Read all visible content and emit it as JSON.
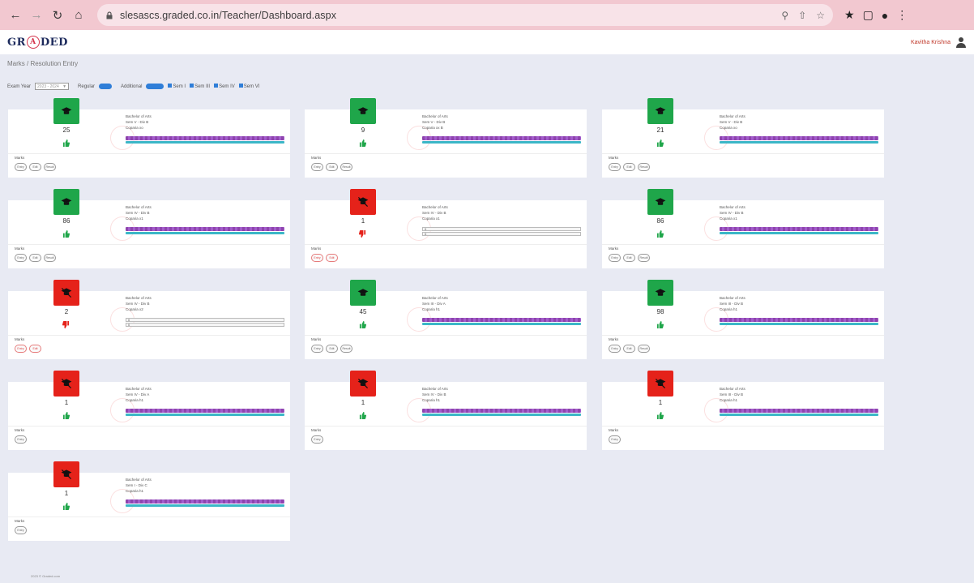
{
  "browser": {
    "url": "slesascs.graded.co.in/Teacher/Dashboard.aspx"
  },
  "app": {
    "logo_left": "GR",
    "logo_mid": "A",
    "logo_right": "DED",
    "user_name": "Kavitha Krishna"
  },
  "breadcrumb": "Marks / Resolution Entry",
  "filters": {
    "exam_year_label": "Exam Year",
    "exam_year_value": "2023 - 2024",
    "regular_label": "Regular",
    "additional_label": "Additional",
    "sems": [
      "Sem I",
      "Sem III",
      "Sem IV",
      "Sem VI"
    ]
  },
  "card_common": {
    "program": "Bachelor of Arts",
    "marks_label": "Marks"
  },
  "cards": [
    {
      "color": "green",
      "count": "25",
      "thumb": "up",
      "sem": "Sem V - Div B",
      "subject": "Coparia xo",
      "bars": "full",
      "buttons": [
        "Entry",
        "Edit",
        "Result"
      ]
    },
    {
      "color": "green",
      "count": "9",
      "thumb": "up",
      "sem": "Sem V - Div B",
      "subject": "Coparia xx B",
      "bars": "full",
      "buttons": [
        "Entry",
        "Edit",
        "Result"
      ]
    },
    {
      "color": "green",
      "count": "21",
      "thumb": "up",
      "sem": "Sem V - Div B",
      "subject": "Coparia xo",
      "bars": "full",
      "buttons": [
        "Entry",
        "Edit",
        "Result"
      ]
    },
    {
      "color": "green",
      "count": "86",
      "thumb": "up",
      "sem": "Sem IV - Div B",
      "subject": "Coparia x1",
      "bars": "full",
      "buttons": [
        "Entry",
        "Edit",
        "Result"
      ]
    },
    {
      "color": "red",
      "count": "1",
      "thumb": "down",
      "sem": "Sem IV - Div B",
      "subject": "Coparia x1",
      "bars": "empty",
      "buttons": [
        "Entry",
        "Edit"
      ]
    },
    {
      "color": "green",
      "count": "86",
      "thumb": "up",
      "sem": "Sem IV - Div B",
      "subject": "Coparia x1",
      "bars": "full",
      "buttons": [
        "Entry",
        "Edit",
        "Result"
      ]
    },
    {
      "color": "red",
      "count": "2",
      "thumb": "down",
      "sem": "Sem IV - Div B",
      "subject": "Coparia x2",
      "bars": "empty",
      "buttons": [
        "Entry",
        "Edit"
      ]
    },
    {
      "color": "green",
      "count": "45",
      "thumb": "up",
      "sem": "Sem III - Div A",
      "subject": "Coparia h1",
      "bars": "full",
      "buttons": [
        "Entry",
        "Edit",
        "Result"
      ]
    },
    {
      "color": "green",
      "count": "98",
      "thumb": "up",
      "sem": "Sem III - Div B",
      "subject": "Coparia h1",
      "bars": "full",
      "buttons": [
        "Entry",
        "Edit",
        "Result"
      ]
    },
    {
      "color": "red",
      "count": "1",
      "thumb": "up",
      "sem": "Sem IV - Div A",
      "subject": "Coparia h1",
      "bars": "full",
      "buttons": [
        "Entry"
      ]
    },
    {
      "color": "red",
      "count": "1",
      "thumb": "up",
      "sem": "Sem IV - Div B",
      "subject": "Coparia h1",
      "bars": "full",
      "buttons": [
        "Entry"
      ]
    },
    {
      "color": "red",
      "count": "1",
      "thumb": "up",
      "sem": "Sem III - Div B",
      "subject": "Coparia h1",
      "bars": "full",
      "buttons": [
        "Entry"
      ]
    },
    {
      "color": "red",
      "count": "1",
      "thumb": "up",
      "sem": "Sem I - Div C",
      "subject": "Coparia h1",
      "bars": "full",
      "buttons": [
        "Entry"
      ]
    }
  ],
  "footer": "2023 © Graded.com"
}
